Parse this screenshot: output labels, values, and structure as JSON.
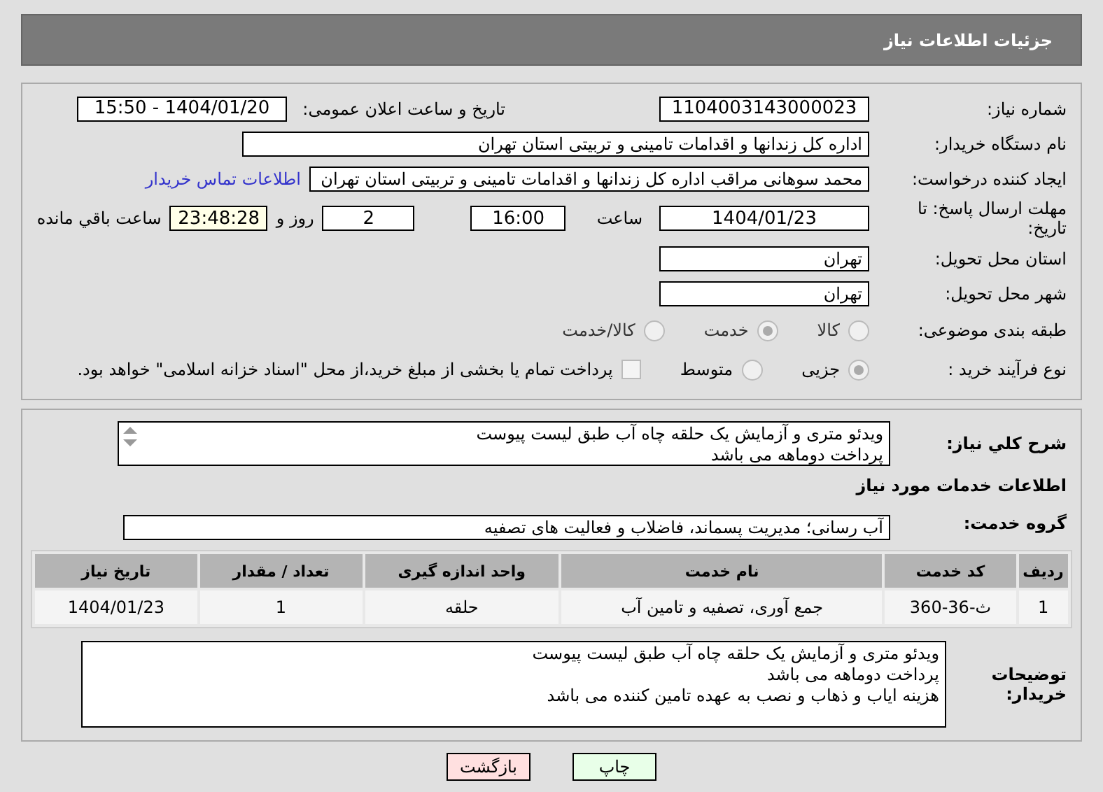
{
  "header": {
    "title": "جزئیات اطلاعات نیاز"
  },
  "details": {
    "need_number": {
      "label": "شماره نیاز:",
      "value": "1104003143000023"
    },
    "announce": {
      "label": "تاریخ و ساعت اعلان عمومی:",
      "value": "1404/01/20 - 15:50"
    },
    "buyer_org": {
      "label": "نام دستگاه خریدار:",
      "value": "اداره کل زندانها و اقدامات تامینی و تربیتی استان تهران"
    },
    "creator": {
      "label": "ایجاد کننده درخواست:",
      "value": "محمد سوهانی مراقب  اداره کل زندانها و اقدامات تامینی و تربیتی استان تهران",
      "link": "اطلاعات تماس خریدار"
    },
    "deadline": {
      "label": "مهلت ارسال پاسخ: تا تاریخ:",
      "date": "1404/01/23",
      "time_label": "ساعت",
      "time": "16:00",
      "days": "2",
      "days_label": "روز و",
      "remaining": "23:48:28",
      "remaining_label": "ساعت باقي مانده"
    },
    "province": {
      "label": "استان محل تحویل:",
      "value": "تهران"
    },
    "city": {
      "label": "شهر محل تحویل:",
      "value": "تهران"
    },
    "category": {
      "label": "طبقه بندی موضوعی:",
      "options": [
        {
          "label": "کالا",
          "selected": false
        },
        {
          "label": "خدمت",
          "selected": true
        },
        {
          "label": "کالا/خدمت",
          "selected": false
        }
      ]
    },
    "process": {
      "label": "نوع فرآیند خرید :",
      "options": [
        {
          "label": "جزیی",
          "selected": true
        },
        {
          "label": "متوسط",
          "selected": false
        }
      ],
      "payment": {
        "label": "پرداخت تمام یا بخشی از مبلغ خرید،از محل \"اسناد خزانه اسلامی\" خواهد بود.",
        "checked": false
      }
    }
  },
  "summary": {
    "label": "شرح کلي نياز:",
    "lines": [
      "ویدئو متری و آزمایش یک حلقه چاه آب طبق لیست پیوست",
      "پرداخت دوماهه می باشد"
    ]
  },
  "services_heading": "اطلاعات خدمات مورد نياز",
  "service_group": {
    "label": "گروه خدمت:",
    "value": "آب رسانی؛ مدیریت پسماند، فاضلاب و فعالیت های تصفیه"
  },
  "table": {
    "columns": [
      "ردیف",
      "کد خدمت",
      "نام خدمت",
      "واحد اندازه گیری",
      "تعداد / مقدار",
      "تاریخ نیاز"
    ],
    "rows": [
      [
        "1",
        "ث-36-360",
        "جمع آوری، تصفیه و تامین آب",
        "حلقه",
        "1",
        "1404/01/23"
      ]
    ]
  },
  "buyer_notes": {
    "label": "توضیحات خریدار:",
    "lines": [
      "ویدئو متری و آزمایش یک حلقه چاه آب طبق لیست پیوست",
      "پرداخت دوماهه می باشد",
      "هزینه ایاب و ذهاب و نصب به عهده تامین کننده می باشد"
    ]
  },
  "buttons": [
    {
      "label": "چاپ",
      "kind": "print"
    },
    {
      "label": "بازگشت",
      "kind": "back"
    }
  ]
}
